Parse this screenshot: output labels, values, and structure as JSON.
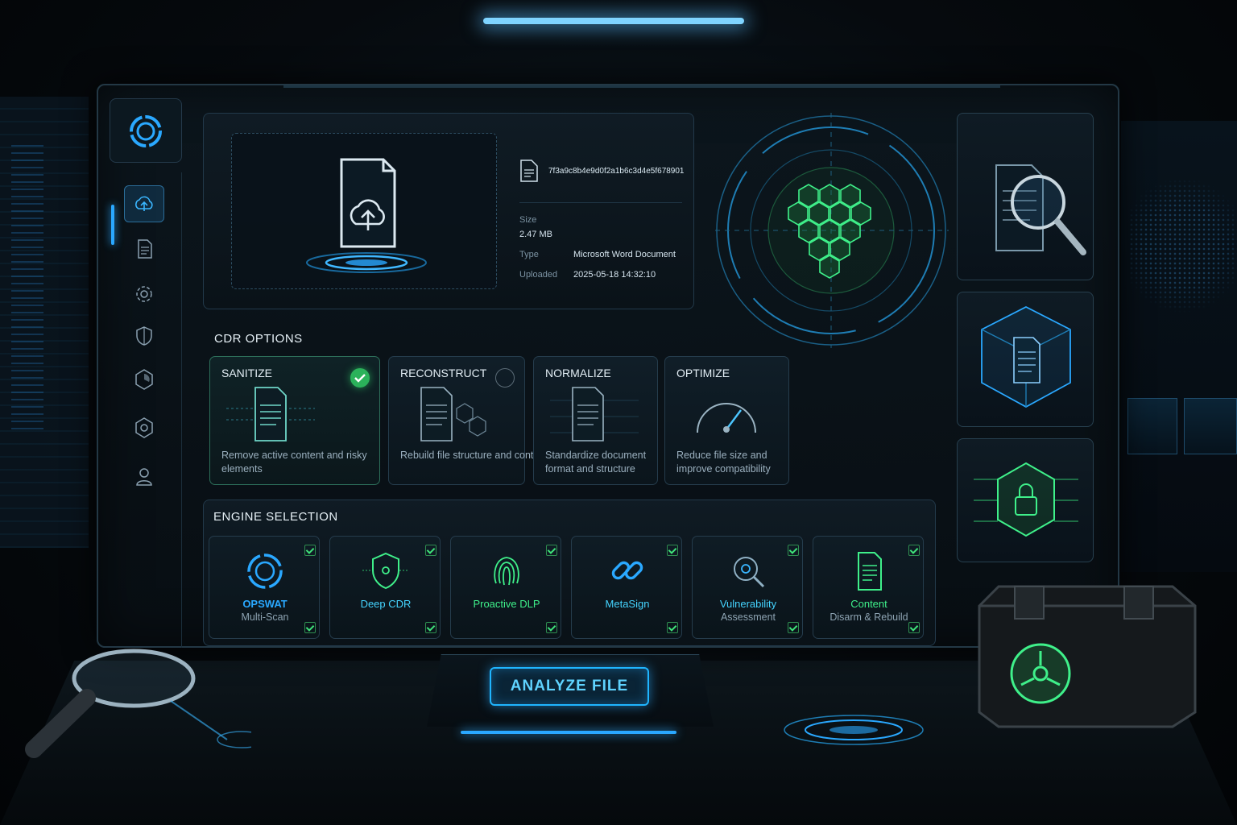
{
  "file": {
    "hash": "7f3a9c8b4e9d0f2a1b6c3d4e5f678901",
    "size_label": "Size",
    "size_value": "2.47 MB",
    "type_label": "Type",
    "type_value": "Microsoft Word Document",
    "uploaded_label": "Uploaded",
    "uploaded_value": "2025-05-18 14:32:10"
  },
  "cdr": {
    "title": "CDR OPTIONS",
    "options": [
      {
        "title": "SANITIZE",
        "desc": "Remove active content and risky elements",
        "selected": true
      },
      {
        "title": "RECONSTRUCT",
        "desc": "Rebuild file structure and content",
        "selected": false
      },
      {
        "title": "NORMALIZE",
        "desc": "Standardize document format and structure",
        "selected": false
      },
      {
        "title": "OPTIMIZE",
        "desc": "Reduce file size and improve compatibility",
        "selected": false
      }
    ]
  },
  "engines": {
    "title": "ENGINE SELECTION",
    "items": [
      {
        "name": "OPSWAT",
        "sub": "Multi-Scan",
        "icon": "opswat-ring-icon"
      },
      {
        "name": "Deep CDR",
        "sub": "",
        "icon": "shield-circuit-icon"
      },
      {
        "name": "Proactive DLP",
        "sub": "",
        "icon": "fingerprint-icon"
      },
      {
        "name": "MetaSign",
        "sub": "",
        "icon": "chain-link-icon"
      },
      {
        "name": "Vulnerability",
        "sub": "Assessment",
        "icon": "biohazard-magnifier-icon"
      },
      {
        "name": "Content",
        "sub": "Disarm & Rebuild",
        "icon": "document-icon"
      }
    ]
  },
  "actions": {
    "analyze_label": "ANALYZE FILE"
  },
  "colors": {
    "accent_blue": "#2aa8ff",
    "accent_green": "#3ff08a",
    "panel_bg": "#0f1c25"
  }
}
